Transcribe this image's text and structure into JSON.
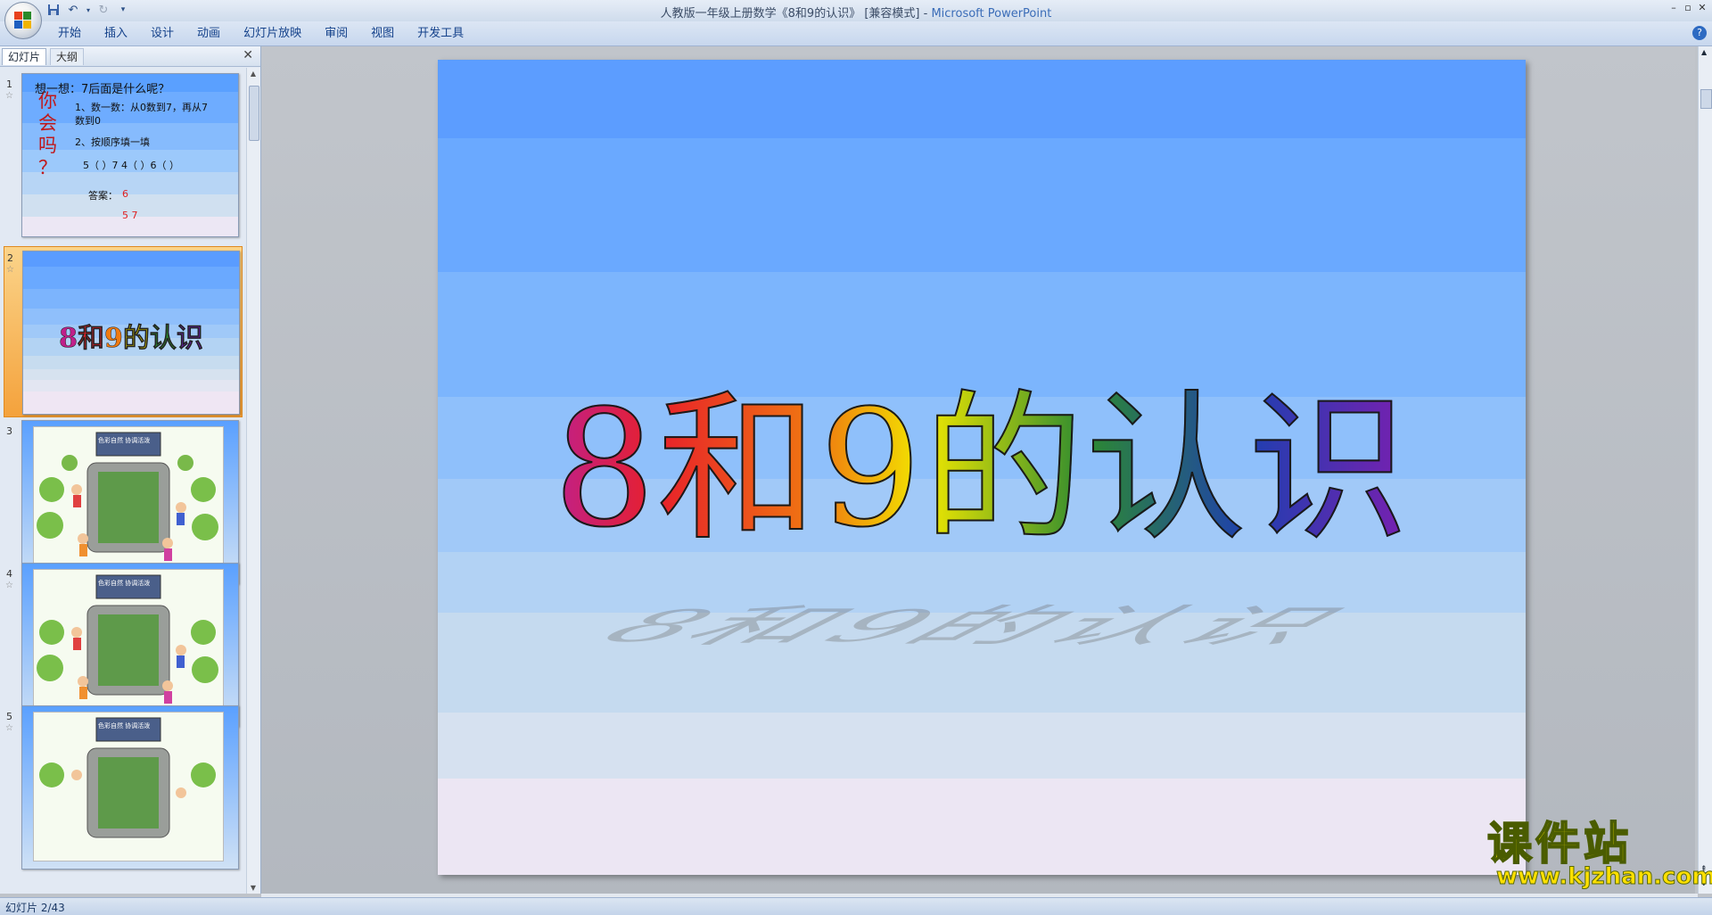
{
  "window": {
    "title_doc": "人教版一年级上册数学《8和9的认识》 [兼容模式] -",
    "title_app": "Microsoft PowerPoint"
  },
  "ribbon": {
    "tabs": [
      "开始",
      "插入",
      "设计",
      "动画",
      "幻灯片放映",
      "审阅",
      "视图",
      "开发工具"
    ]
  },
  "left_pane": {
    "tabs": [
      "幻灯片",
      "大纲"
    ],
    "slides": [
      {
        "number": "1",
        "side_text": [
          "你",
          "会",
          "吗",
          "？"
        ],
        "title": "想一想：7后面是什么呢？",
        "line1a": "1、数一数：从0数到7，再从7",
        "line1b": "数到0",
        "line2": "2、按顺序填一填",
        "line3": "5（ ）7    4（ ）6（ ）",
        "answer_label": "答案：",
        "answer1": "6",
        "answer2": "5 7"
      },
      {
        "number": "2",
        "title": "8和9的认识"
      },
      {
        "number": "3",
        "caption": "色彩自然 协调活泼"
      },
      {
        "number": "4",
        "caption": "色彩自然 协调活泼"
      },
      {
        "number": "5",
        "caption": "色彩自然 协调活泼"
      }
    ]
  },
  "slide": {
    "title_chars": [
      "8",
      "和",
      "9",
      "的",
      "认",
      "识"
    ],
    "title_colors": [
      "#c0208a",
      "#e8202a",
      "#f07a10",
      "#f2e800",
      "#2c8a30",
      "#1f3fb0",
      "#7a1fb0"
    ]
  },
  "status": {
    "slide_counter": "幻灯片 2/43"
  },
  "watermark": {
    "cn": "课件站",
    "url": "www.kjzhan.com"
  },
  "colors": {
    "selected_thumb": "#f4a23c",
    "ribbon_text": "#15428b"
  }
}
